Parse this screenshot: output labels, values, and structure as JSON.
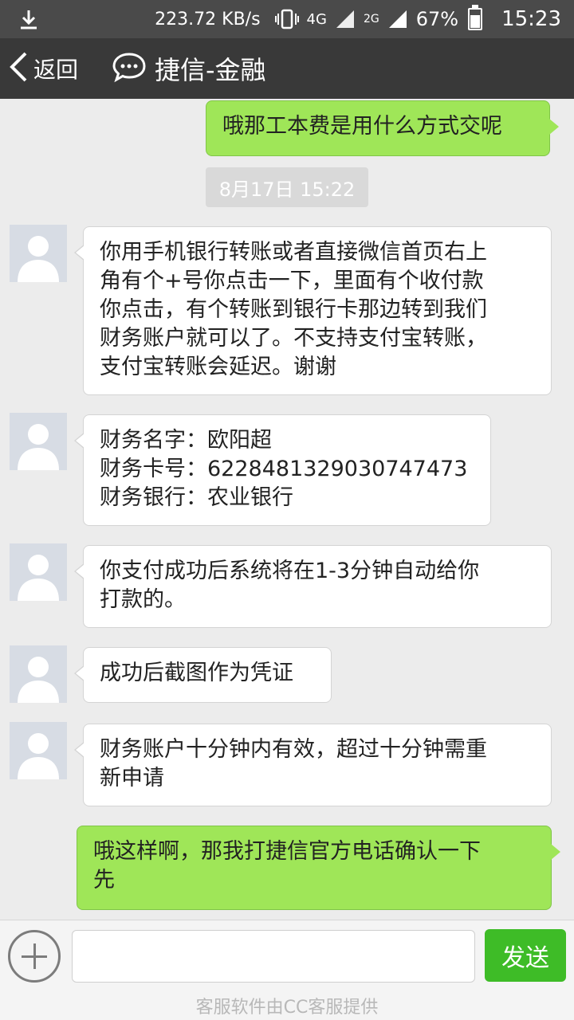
{
  "status_bar": {
    "speed": "223.72 KB/s",
    "network_label": "4G",
    "network_label_2": "2G",
    "battery_percent": "67%",
    "battery_level": 0.67,
    "time": "15:23",
    "icons": [
      "download-icon",
      "vibrate-icon",
      "signal-icon",
      "battery-icon"
    ]
  },
  "title_bar": {
    "back_label": "返回",
    "title": "捷信-金融",
    "icons": [
      "back-chevron-icon",
      "chat-bubble-icon"
    ]
  },
  "messages": [
    {
      "dir": "out",
      "lines": [
        "哦那工本费是用什么方式交呢"
      ]
    },
    {
      "dir": "in",
      "lines": [
        "你用手机银行转账或者直接微信首页右上",
        "角有个+号你点击一下，里面有个收付款",
        "你点击，有个转账到银行卡那边转到我们",
        "财务账户就可以了。不支持支付宝转账，",
        "支付宝转账会延迟。谢谢"
      ]
    },
    {
      "dir": "in",
      "lines": [
        "财务名字：欧阳超",
        "财务卡号：6228481329030747473",
        "财务银行：农业银行"
      ]
    },
    {
      "dir": "in",
      "lines": [
        "你支付成功后系统将在1-3分钟自动给你",
        "打款的。"
      ]
    },
    {
      "dir": "in",
      "lines": [
        "成功后截图作为凭证"
      ]
    },
    {
      "dir": "in",
      "lines": [
        "财务账户十分钟内有效，超过十分钟需重",
        "新申请"
      ]
    },
    {
      "dir": "out",
      "lines": [
        "哦这样啊，那我打捷信官方电话确认一下",
        "先"
      ]
    }
  ],
  "timestamp": "8月17日 15:22",
  "input_bar": {
    "placeholder": "",
    "send_label": "发送"
  },
  "footer": "客服软件由CC客服提供"
}
